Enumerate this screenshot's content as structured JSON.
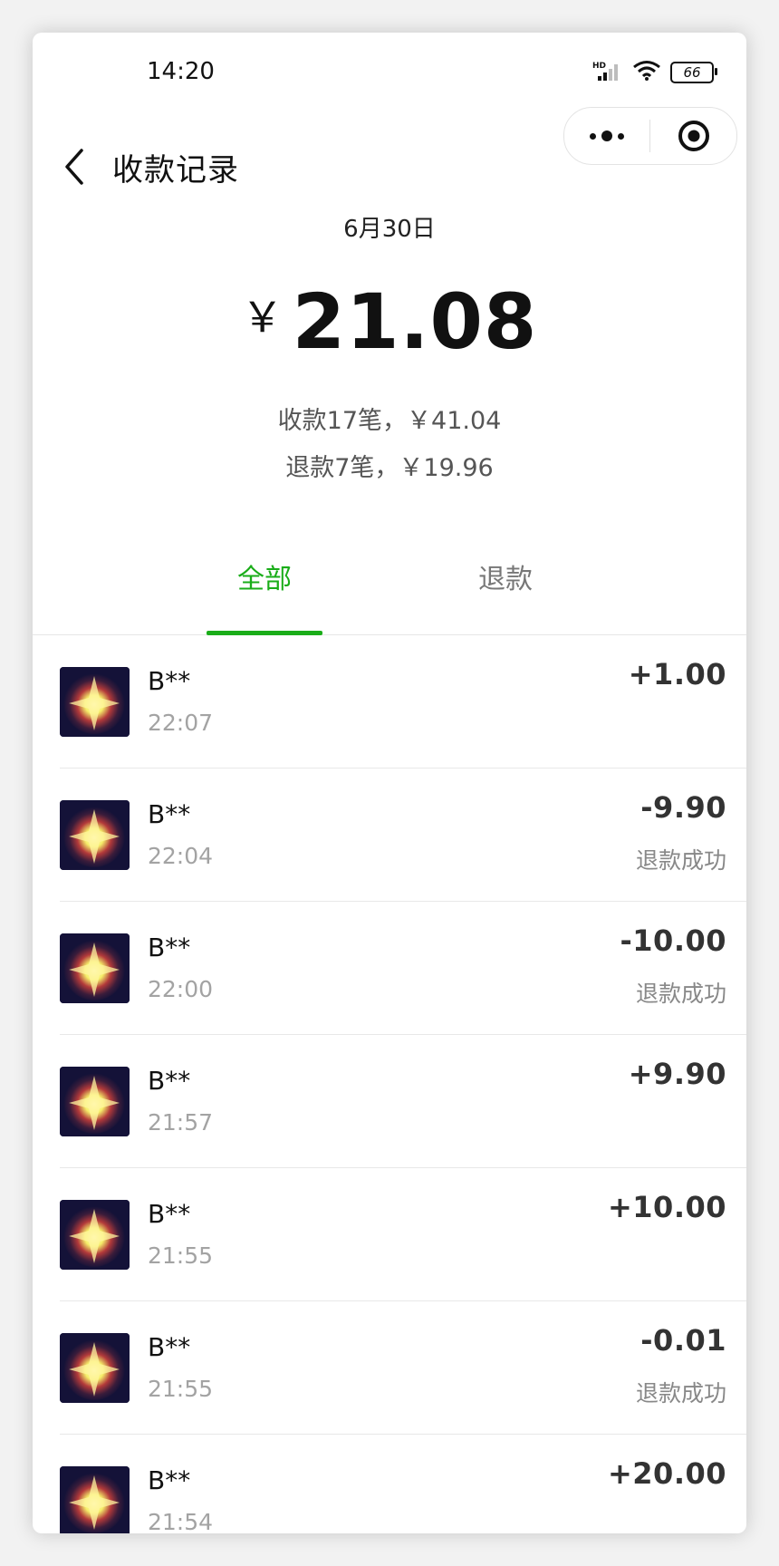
{
  "status_bar": {
    "time": "14:20",
    "battery": "66",
    "hd_label": "HD"
  },
  "nav": {
    "title": "收款记录"
  },
  "summary": {
    "date": "6月30日",
    "currency": "￥",
    "total": "21.08",
    "received": "收款17笔，￥41.04",
    "refunded": "退款7笔，￥19.96"
  },
  "tabs": [
    {
      "label": "全部",
      "active": true
    },
    {
      "label": "退款",
      "active": false
    }
  ],
  "colors": {
    "accent": "#1aad19",
    "text": "#111111",
    "muted": "#a3a3a3"
  },
  "records": [
    {
      "name": "B**",
      "time": "22:07",
      "amount": "+1.00",
      "status": ""
    },
    {
      "name": "B**",
      "time": "22:04",
      "amount": "-9.90",
      "status": "退款成功"
    },
    {
      "name": "B**",
      "time": "22:00",
      "amount": "-10.00",
      "status": "退款成功"
    },
    {
      "name": "B**",
      "time": "21:57",
      "amount": "+9.90",
      "status": ""
    },
    {
      "name": "B**",
      "time": "21:55",
      "amount": "+10.00",
      "status": ""
    },
    {
      "name": "B**",
      "time": "21:55",
      "amount": "-0.01",
      "status": "退款成功"
    },
    {
      "name": "B**",
      "time": "21:54",
      "amount": "+20.00",
      "status": ""
    }
  ]
}
